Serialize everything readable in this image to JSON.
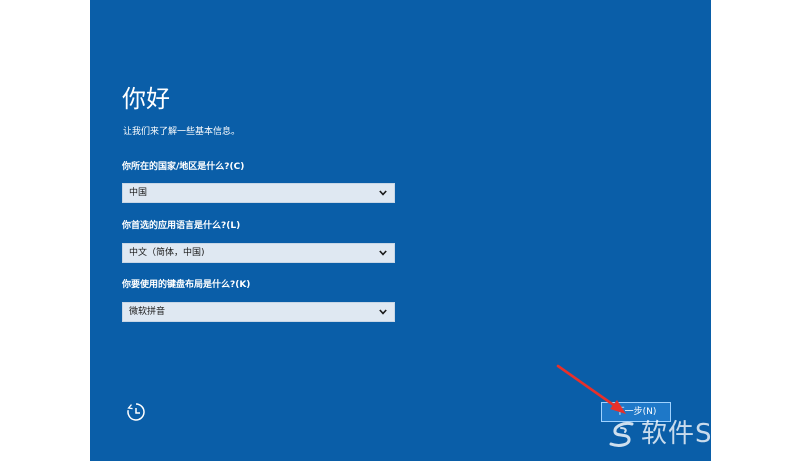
{
  "screen": {
    "title": "你好",
    "subtitle": "让我们来了解一些基本信息。"
  },
  "fields": [
    {
      "label": "你所在的国家/地区是什么?(C)",
      "value": "中国"
    },
    {
      "label": "你首选的应用语言是什么?(L)",
      "value": "中文（简体，中国)"
    },
    {
      "label": "你要使用的键盘布局是什么?(K)",
      "value": "微软拼音"
    }
  ],
  "footer": {
    "accessibility_icon": "ease-of-access-icon",
    "next_label": "下一步(N)"
  },
  "annotation": {
    "arrow_color": "#e8302a"
  },
  "watermark": {
    "text": "软件SOS"
  },
  "colors": {
    "panel_background": "#0a5ea8",
    "dropdown_background": "#dfe8f2",
    "button_background": "#1e78c8"
  }
}
